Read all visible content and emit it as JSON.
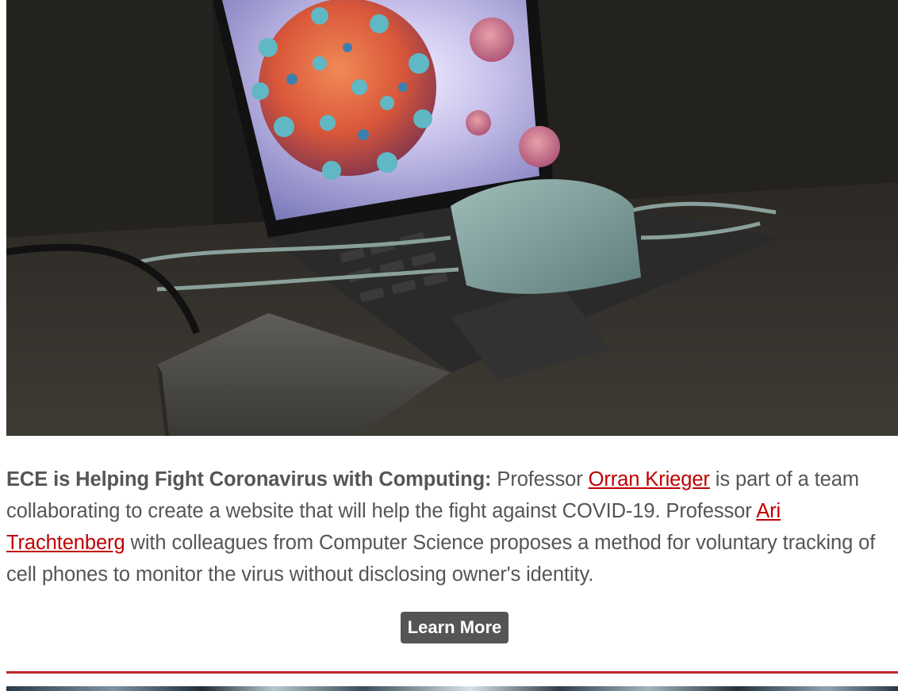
{
  "hero_image": {
    "description_icon": "laptop-virus-photo-icon"
  },
  "article": {
    "headline": "ECE is Helping Fight Coronavirus with Computing:",
    "text_1": " Professor ",
    "link_1": "Orran Krieger",
    "text_2": " is part of a team collaborating to create a website that will help the fight against COVID-19. Professor ",
    "link_2": "Ari Trachtenberg",
    "text_3": " with colleagues from Computer Science proposes a method for voluntary tracking of cell phones to monitor the virus without disclosing owner's identity."
  },
  "cta": {
    "label": "Learn More"
  },
  "colors": {
    "link": "#c00000",
    "divider": "#c1272d",
    "button_bg": "#555555",
    "body_text": "#555555"
  }
}
